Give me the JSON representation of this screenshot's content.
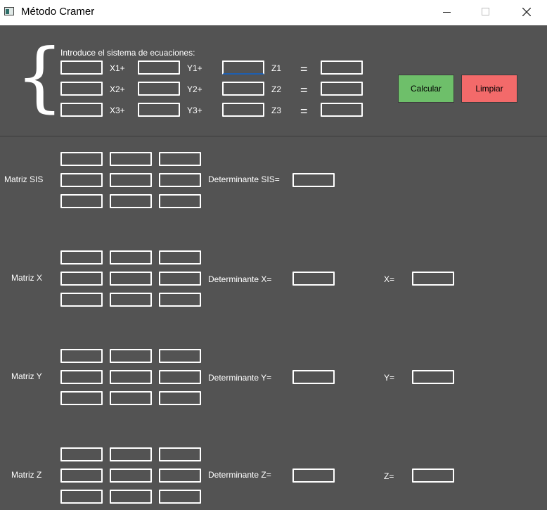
{
  "window": {
    "title": "Método Cramer"
  },
  "input_section": {
    "prompt": "Introduce el sistema de ecuaciones:",
    "row_labels": [
      {
        "x": "X1+",
        "y": "Y1+",
        "z": "Z1",
        "eq": "="
      },
      {
        "x": "X2+",
        "y": "Y2+",
        "z": "Z2",
        "eq": "="
      },
      {
        "x": "X3+",
        "y": "Y3+",
        "z": "Z3",
        "eq": "="
      }
    ],
    "values": [
      [
        "",
        "",
        "",
        ""
      ],
      [
        "",
        "",
        "",
        ""
      ],
      [
        "",
        "",
        "",
        ""
      ]
    ]
  },
  "buttons": {
    "calcular": "Calcular",
    "limpiar": "Limpiar"
  },
  "matrices": [
    {
      "label": "Matriz SIS",
      "det_label": "Determinante SIS=",
      "result_label": ""
    },
    {
      "label": "Matriz X",
      "det_label": "Determinante X=",
      "result_label": "X="
    },
    {
      "label": "Matriz Y",
      "det_label": "Determinante Y=",
      "result_label": "Y="
    },
    {
      "label": "Matriz Z",
      "det_label": "Determinante Z=",
      "result_label": "Z="
    }
  ],
  "colors": {
    "background": "#535353",
    "calcular": "#6ebf6a",
    "limpiar": "#f36a6a",
    "focus": "#1e5fb0"
  }
}
